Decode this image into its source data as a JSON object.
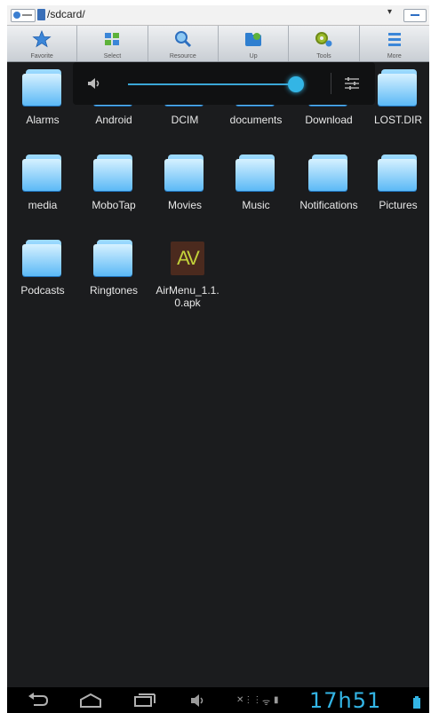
{
  "pathbar": {
    "path": "/sdcard/"
  },
  "toolbar": {
    "buttons": [
      {
        "label": "Favorite",
        "icon": "star-icon"
      },
      {
        "label": "Select",
        "icon": "select-icon"
      },
      {
        "label": "Resource",
        "icon": "search-icon"
      },
      {
        "label": "Up",
        "icon": "up-folder-icon"
      },
      {
        "label": "Tools",
        "icon": "tools-icon"
      },
      {
        "label": "More",
        "icon": "menu-icon"
      }
    ]
  },
  "volume": {
    "level": 1.0,
    "accent": "#33b5e5"
  },
  "files": [
    {
      "name": "Alarms",
      "type": "folder"
    },
    {
      "name": "Android",
      "type": "folder"
    },
    {
      "name": "DCIM",
      "type": "folder"
    },
    {
      "name": "documents",
      "type": "folder"
    },
    {
      "name": "Download",
      "type": "folder"
    },
    {
      "name": "LOST.DIR",
      "type": "folder"
    },
    {
      "name": "media",
      "type": "folder"
    },
    {
      "name": "MoboTap",
      "type": "folder"
    },
    {
      "name": "Movies",
      "type": "folder"
    },
    {
      "name": "Music",
      "type": "folder"
    },
    {
      "name": "Notifications",
      "type": "folder"
    },
    {
      "name": "Pictures",
      "type": "folder"
    },
    {
      "name": "Podcasts",
      "type": "folder"
    },
    {
      "name": "Ringtones",
      "type": "folder"
    },
    {
      "name": "AirMenu_1.1.0.apk",
      "type": "apk",
      "icon_text": "AV"
    }
  ],
  "statusbar": {
    "clock": "17h51"
  }
}
